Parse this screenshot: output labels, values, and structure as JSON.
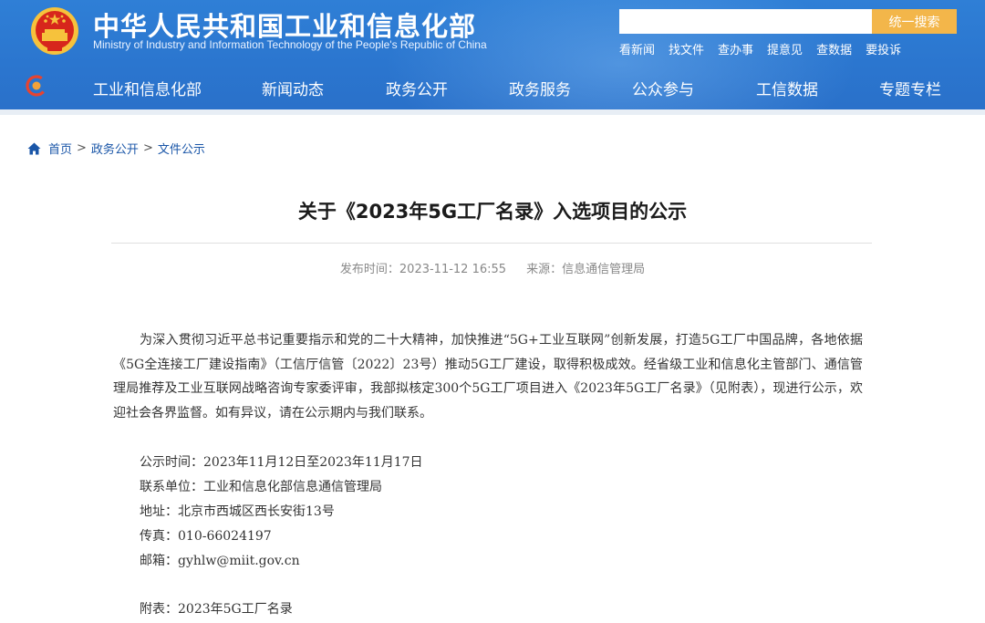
{
  "header": {
    "site_title": "中华人民共和国工业和信息化部",
    "site_subtitle": "Ministry of Industry and Information Technology of the People's Republic of China",
    "search_placeholder": "",
    "search_button": "统一搜索",
    "quick_links": [
      "看新闻",
      "找文件",
      "查办事",
      "提意见",
      "查数据",
      "要投诉"
    ],
    "nav": [
      "工业和信息化部",
      "新闻动态",
      "政务公开",
      "政务服务",
      "公众参与",
      "工信数据",
      "专题专栏"
    ],
    "colors": {
      "header_blue": "#2b76cf",
      "search_button": "#f3b64a",
      "emblem_red": "#d7261c",
      "emblem_gold": "#f6c23c"
    }
  },
  "breadcrumb": {
    "icon": "home-icon",
    "items": [
      "首页",
      "政务公开",
      "文件公示"
    ],
    "separator": ">"
  },
  "article": {
    "title": "关于《2023年5G工厂名录》入选项目的公示",
    "publish_label": "发布时间：",
    "publish_time": "2023-11-12 16:55",
    "source_label": "来源：",
    "source": "信息通信管理局",
    "paragraph": "为深入贯彻习近平总书记重要指示和党的二十大精神，加快推进“5G+工业互联网”创新发展，打造5G工厂中国品牌，各地依据《5G全连接工厂建设指南》（工信厅信管〔2022〕23号）推动5G工厂建设，取得积极成效。经省级工业和信息化主管部门、通信管理局推荐及工业互联网战略咨询专家委评审，我部拟核定300个5G工厂项目进入《2023年5G工厂名录》（见附表），现进行公示，欢迎社会各界监督。如有异议，请在公示期内与我们联系。",
    "info": [
      "公示时间：2023年11月12日至2023年11月17日",
      "联系单位：工业和信息化部信息通信管理局",
      "地址：北京市西城区西长安街13号",
      "传真：010-66024197",
      "邮箱：gyhlw@miit.gov.cn"
    ],
    "attachment": "附表：2023年5G工厂名录"
  }
}
